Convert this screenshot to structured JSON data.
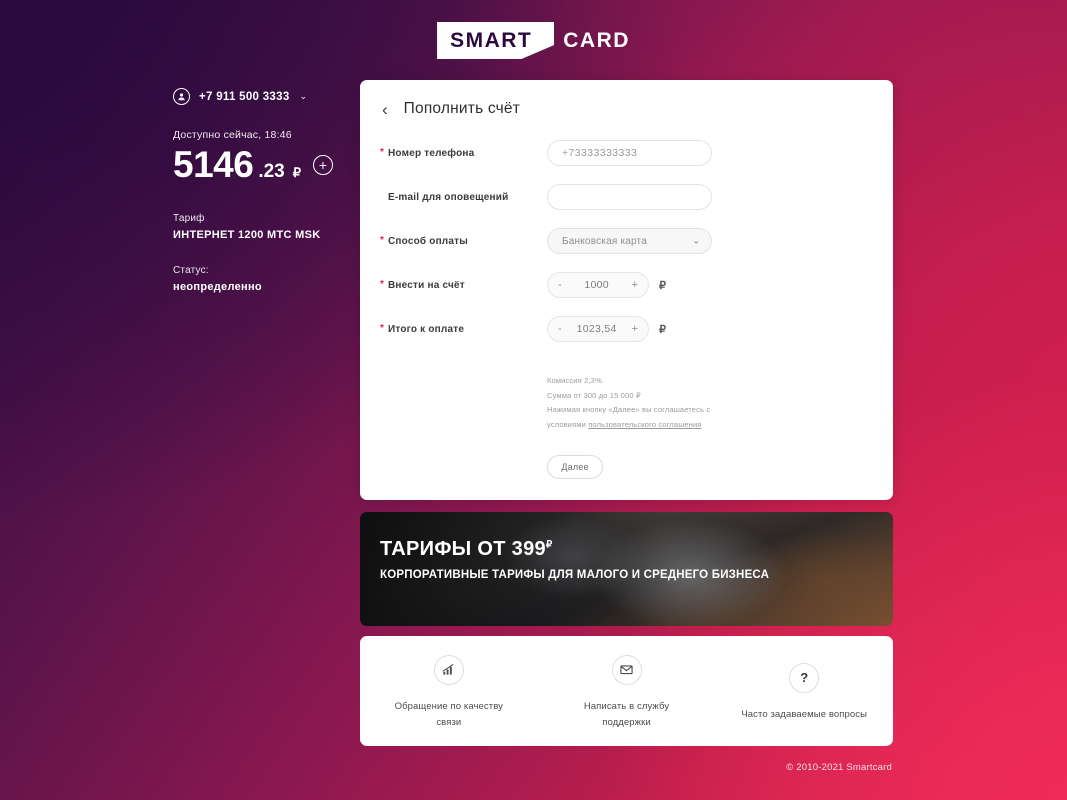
{
  "brand": {
    "part1": "SMART",
    "part2": "CARD"
  },
  "sidebar": {
    "avatar_icon": "user-circle-icon",
    "phone": "+7 911 500 3333",
    "chevron": "⌄",
    "available_label": "Доступно сейчас, 18:46",
    "balance_int": "5146",
    "balance_frac": ".23",
    "currency": "₽",
    "topup_icon": "+",
    "tariff_key": "Тариф",
    "tariff_value": "ИНТЕРНЕТ 1200 МТС MSK",
    "status_key": "Статус:",
    "status_value": "неопределенно"
  },
  "card": {
    "back_icon": "‹",
    "title": "Пополнить счёт",
    "required_mark": "*",
    "fields": {
      "phone": {
        "label": "Номер телефона",
        "value": "+73333333333",
        "placeholder": "+73333333333",
        "required": true
      },
      "email": {
        "label": "E-mail для оповещений",
        "value": "",
        "placeholder": "",
        "required": false
      },
      "method": {
        "label": "Способ оплаты",
        "value": "Банковская карта",
        "required": true,
        "arrow": "⌄",
        "options": [
          "Банковская карта"
        ]
      },
      "amount": {
        "label": "Внести на счёт",
        "value": "1000",
        "required": true,
        "minus": "-",
        "plus": "+",
        "currency": "₽"
      },
      "total": {
        "label": "Итого к оплате",
        "value": "1023,54",
        "required": true,
        "minus": "-",
        "plus": "+",
        "currency": "₽"
      }
    },
    "fine_print": {
      "line1": "Комиссия 2,3%.",
      "line2": "Сумма от 300 до 15 000 ₽",
      "line3": "Нажимая кнопку «Далее» вы соглашаетесь с",
      "line4_prefix": "условиями ",
      "line4_link": "пользовательского соглашения"
    },
    "submit_label": "Далее"
  },
  "banner": {
    "headline": "ТАРИФЫ ОТ 399",
    "headline_sup": "₽",
    "subheadline": "КОРПОРАТИВНЫЕ ТАРИФЫ ДЛЯ МАЛОГО И СРЕДНЕГО БИЗНЕСА"
  },
  "help": {
    "items": [
      {
        "icon": "signal-bars-icon",
        "label": "Обращение по качеству связи"
      },
      {
        "icon": "envelope-icon",
        "label": "Написать в службу поддержки"
      },
      {
        "icon": "question-mark-icon",
        "label": "Часто задаваемые вопросы",
        "glyph": "?"
      }
    ]
  },
  "footer": {
    "copyright": "© 2010-2021 Smartcard"
  },
  "colors": {
    "accent_red": "#e8254f",
    "bg_start": "#2b0a40",
    "bg_end": "#ea2a59",
    "card_bg": "#ffffff"
  }
}
